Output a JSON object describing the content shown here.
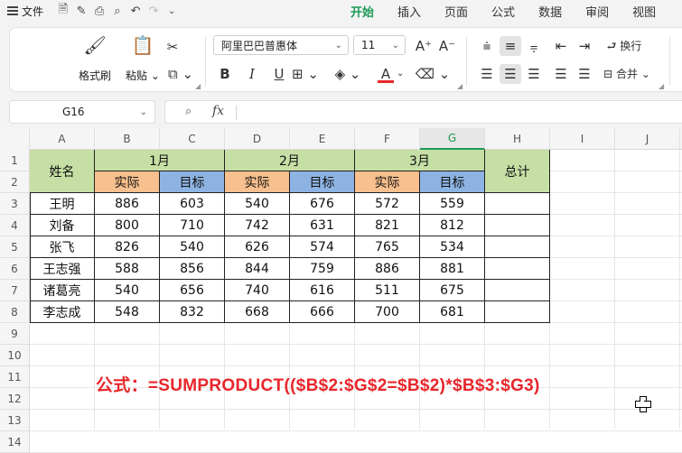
{
  "menu": {
    "file_label": "文件",
    "tabs": [
      {
        "label": "开始",
        "active": true
      },
      {
        "label": "插入",
        "active": false
      },
      {
        "label": "页面",
        "active": false
      },
      {
        "label": "公式",
        "active": false
      },
      {
        "label": "数据",
        "active": false
      },
      {
        "label": "审阅",
        "active": false
      },
      {
        "label": "视图",
        "active": false
      }
    ]
  },
  "ribbon": {
    "format_painter": "格式刷",
    "paste": "粘贴",
    "font_name": "阿里巴巴普惠体",
    "font_size": "11",
    "wrap_text": "换行",
    "merge": "合并",
    "font_color": "#e8262b"
  },
  "formula_bar": {
    "name_box": "G16",
    "fx_label": "fx",
    "content": ""
  },
  "columns": [
    "A",
    "B",
    "C",
    "D",
    "E",
    "F",
    "G",
    "H",
    "I",
    "J"
  ],
  "selected_column": "G",
  "rows": [
    "1",
    "2",
    "3",
    "4",
    "5",
    "6",
    "7",
    "8",
    "9",
    "10",
    "11",
    "12",
    "13",
    "14"
  ],
  "table": {
    "name_header": "姓名",
    "months": [
      "1月",
      "2月",
      "3月"
    ],
    "sub_headers": [
      "实际",
      "目标",
      "实际",
      "目标",
      "实际",
      "目标"
    ],
    "total_header": "总计",
    "records": [
      {
        "name": "王明",
        "values": [
          "886",
          "603",
          "540",
          "676",
          "572",
          "559"
        ]
      },
      {
        "name": "刘备",
        "values": [
          "800",
          "710",
          "742",
          "631",
          "821",
          "812"
        ]
      },
      {
        "name": "张飞",
        "values": [
          "826",
          "540",
          "626",
          "574",
          "765",
          "534"
        ]
      },
      {
        "name": "王志强",
        "values": [
          "588",
          "856",
          "844",
          "759",
          "886",
          "881"
        ]
      },
      {
        "name": "诸葛亮",
        "values": [
          "540",
          "656",
          "740",
          "616",
          "511",
          "675"
        ]
      },
      {
        "name": "李志成",
        "values": [
          "548",
          "832",
          "668",
          "666",
          "700",
          "681"
        ]
      }
    ]
  },
  "note": "公式：=SUMPRODUCT(($B$2:$G$2=$B$2)*$B$3:$G3)",
  "colors": {
    "accent": "#1e9a57",
    "header_green": "#c6dfa4",
    "actual_orange": "#f8c08e",
    "target_blue": "#8db3e2",
    "note_red": "#e8262b"
  }
}
